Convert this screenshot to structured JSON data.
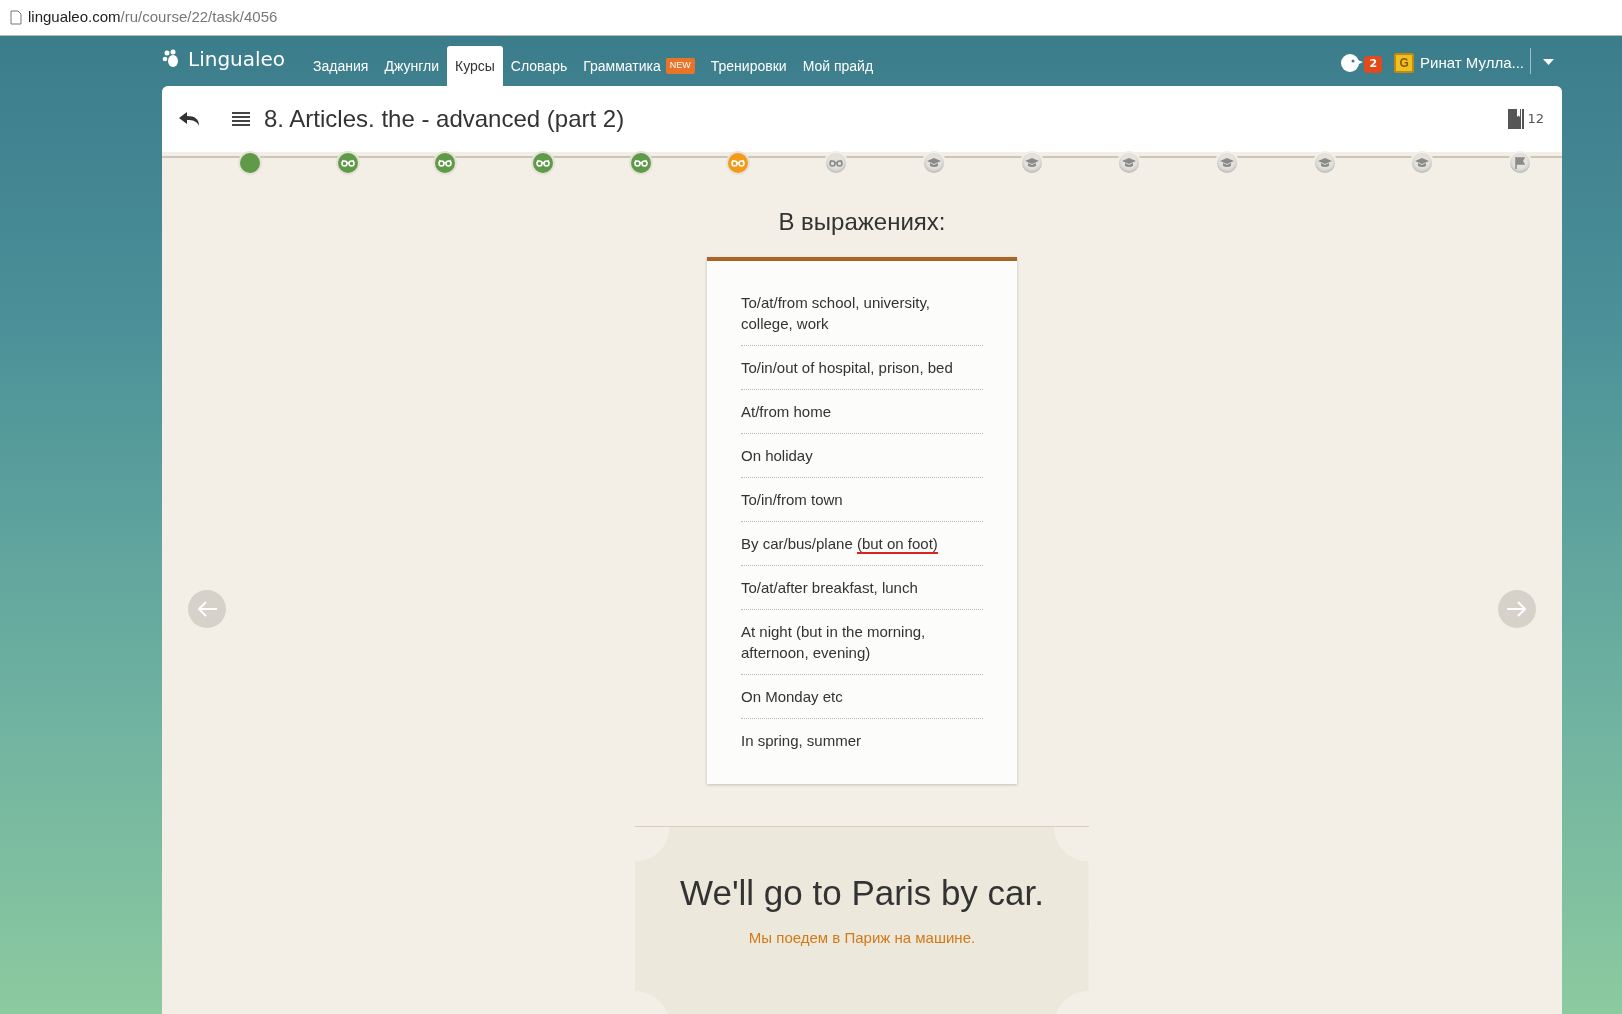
{
  "address_bar": {
    "host": "lingualeo.com",
    "path": "/ru/course/22/task/4056"
  },
  "brand": "Lingualeo",
  "nav": [
    {
      "label": "Задания",
      "selected": false
    },
    {
      "label": "Джунгли",
      "selected": false
    },
    {
      "label": "Курсы",
      "selected": true
    },
    {
      "label": "Словарь",
      "selected": false
    },
    {
      "label": "Грамматика",
      "selected": false,
      "badge": "NEW"
    },
    {
      "label": "Тренировки",
      "selected": false
    },
    {
      "label": "Мой прайд",
      "selected": false
    }
  ],
  "notifications": {
    "count": "2"
  },
  "user": {
    "level_letter": "G",
    "name": "Ринат Мулла..."
  },
  "lesson": {
    "title": "8. Articles. the - advanced (part 2)",
    "words": "12"
  },
  "steps": [
    {
      "kind": "start",
      "selected": false
    },
    {
      "kind": "lesson",
      "selected": false
    },
    {
      "kind": "lesson",
      "selected": false
    },
    {
      "kind": "lesson",
      "selected": false
    },
    {
      "kind": "lesson",
      "selected": false
    },
    {
      "kind": "lesson",
      "selected": true
    },
    {
      "kind": "lesson",
      "selected": false
    },
    {
      "kind": "test",
      "selected": false
    },
    {
      "kind": "test",
      "selected": false
    },
    {
      "kind": "test",
      "selected": false
    },
    {
      "kind": "test",
      "selected": false
    },
    {
      "kind": "test",
      "selected": false
    },
    {
      "kind": "test",
      "selected": false
    },
    {
      "kind": "finish",
      "selected": false
    }
  ],
  "heading": "В выражениях:",
  "expressions": [
    {
      "text": "To/at/from school, university, college, work"
    },
    {
      "text": "To/in/out of hospital, prison, bed"
    },
    {
      "text": "At/from home"
    },
    {
      "text": "On holiday"
    },
    {
      "text": "To/in/from town"
    },
    {
      "text": "By car/bus/plane ",
      "underlined": "(but on foot)"
    },
    {
      "text": "To/at/after breakfast, lunch"
    },
    {
      "text": "At night (but in the morning, afternoon, evening)"
    },
    {
      "text": "On Monday etc"
    },
    {
      "text": "In spring, summer"
    }
  ],
  "example": {
    "sentence": "We'll go to Paris by car.",
    "translation": "Мы поедем в Париж на машине."
  }
}
